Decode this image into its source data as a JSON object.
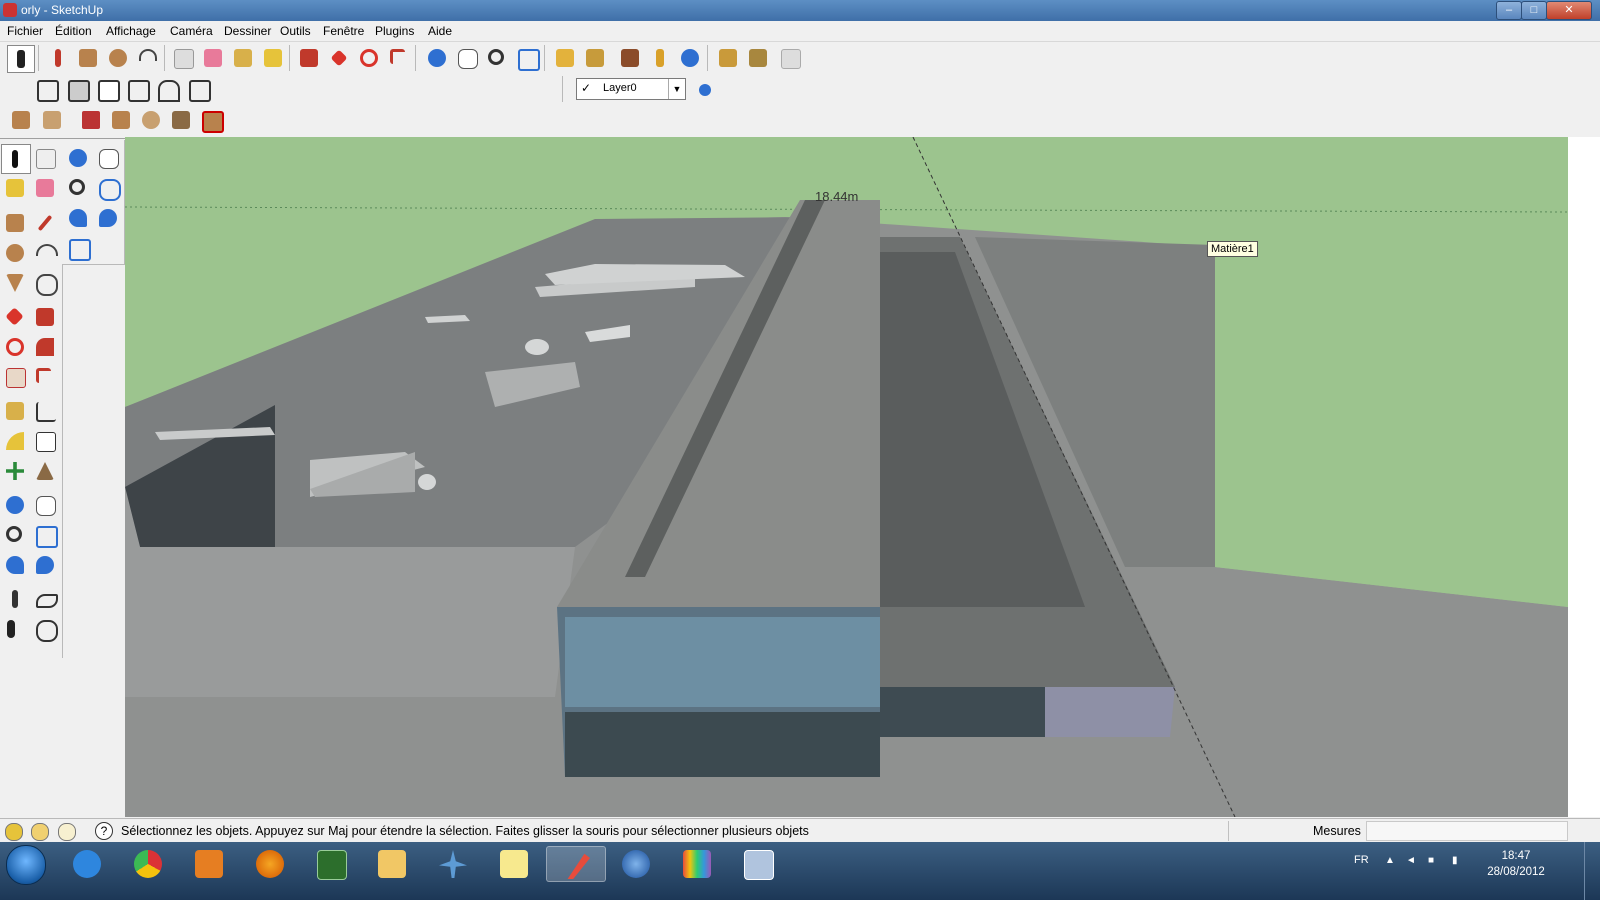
{
  "window": {
    "title": "orly - SketchUp",
    "controls": {
      "minimize": "–",
      "maximize": "□",
      "close": "✕"
    }
  },
  "menu": {
    "items": [
      "Fichier",
      "Édition",
      "Affichage",
      "Caméra",
      "Dessiner",
      "Outils",
      "Fenêtre",
      "Plugins",
      "Aide"
    ]
  },
  "toolbar": {
    "layer": {
      "checked": "✓",
      "name": "Layer0",
      "arrow": "▼"
    },
    "buttons": [
      "select-icon",
      "pencil-icon",
      "rectangle-icon",
      "circle-icon",
      "arc-icon",
      "eraser-icon",
      "paint-icon",
      "tape-icon",
      "bucket-icon",
      "pushpull-icon",
      "move-icon",
      "rotate-icon",
      "followme-icon",
      "orbit-icon",
      "pan-icon",
      "zoom-icon",
      "zoom-extents-icon",
      "get-models-icon",
      "share-model-icon",
      "components-icon",
      "location-icon",
      "toggle-terrain-icon",
      "google-earth-icon",
      "get-photo-icon",
      "extensions-icon",
      "send-icon"
    ]
  },
  "viewport": {
    "tooltip": "Matière1",
    "dimension": "18.44m",
    "sky_color": "#9cc48e",
    "ground_color": "#8d8d8d"
  },
  "status": {
    "message": "Sélectionnez les objets. Appuyez sur Maj pour étendre la sélection. Faites glisser la souris pour sélectionner plusieurs objets",
    "help_icon": "?",
    "measures_label": "Mesures",
    "measures_value": ""
  },
  "taskbar": {
    "apps": [
      "internet-explorer-icon",
      "chrome-icon",
      "media-player-icon",
      "firefox-icon",
      "chip-app-icon",
      "explorer-folder-icon",
      "flight-app-icon",
      "sticky-notes-icon",
      "sketchup-icon",
      "google-earth-icon",
      "color-app-icon",
      "archive-app-icon"
    ],
    "active": "sketchup-icon",
    "language": "FR",
    "time": "18:47",
    "date": "28/08/2012"
  }
}
